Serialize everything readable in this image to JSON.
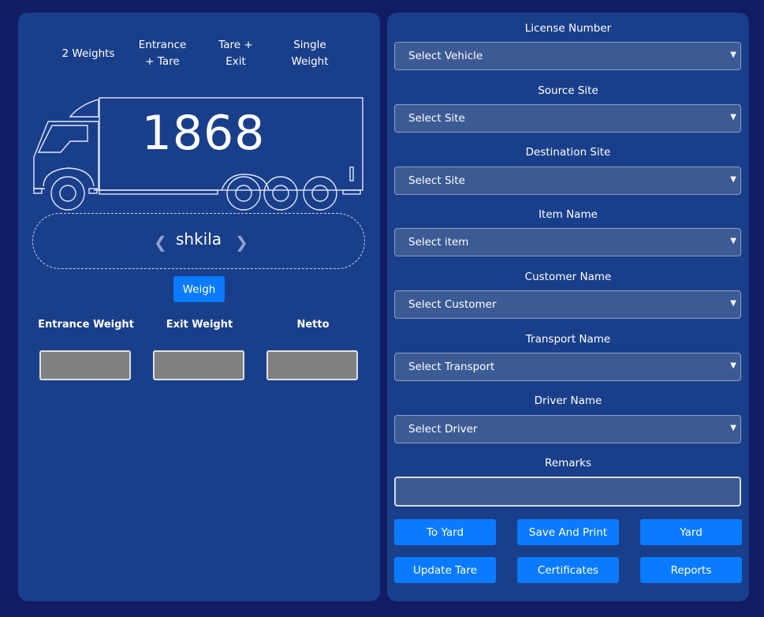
{
  "modes": [
    {
      "line1": "",
      "line2": "2 Weights"
    },
    {
      "line1": "Entrance",
      "line2": "+ Tare"
    },
    {
      "line1": "Tare +",
      "line2": "Exit"
    },
    {
      "line1": "Single",
      "line2": "Weight"
    }
  ],
  "scale": {
    "current_weight": "1868",
    "name": "shkila",
    "prev_icon": "chevron-left-icon",
    "next_icon": "chevron-right-icon",
    "weigh_label": "Weigh"
  },
  "weights": {
    "entrance_label": "Entrance Weight",
    "exit_label": "Exit Weight",
    "netto_label": "Netto",
    "entrance_value": "",
    "exit_value": "",
    "netto_value": ""
  },
  "form": {
    "fields": [
      {
        "label": "License Number",
        "value": "Select Vehicle"
      },
      {
        "label": "Source Site",
        "value": "Select Site"
      },
      {
        "label": "Destination Site",
        "value": "Select Site"
      },
      {
        "label": "Item Name",
        "value": "Select item"
      },
      {
        "label": "Customer Name",
        "value": "Select Customer"
      },
      {
        "label": "Transport Name",
        "value": "Select Transport"
      },
      {
        "label": "Driver Name",
        "value": "Select Driver"
      }
    ],
    "remarks_label": "Remarks",
    "remarks_value": "",
    "dropdown_arrow": "▼"
  },
  "actions": {
    "to_yard": "To Yard",
    "save_and_print": "Save And Print",
    "yard": "Yard",
    "update_tare": "Update Tare",
    "certificates": "Certificates",
    "reports": "Reports"
  },
  "colors": {
    "background": "#121c63",
    "panel": "#1a3f8a",
    "accent": "#0a7bff",
    "select_bg": "#3c5b95",
    "weight_box": "#808080"
  }
}
